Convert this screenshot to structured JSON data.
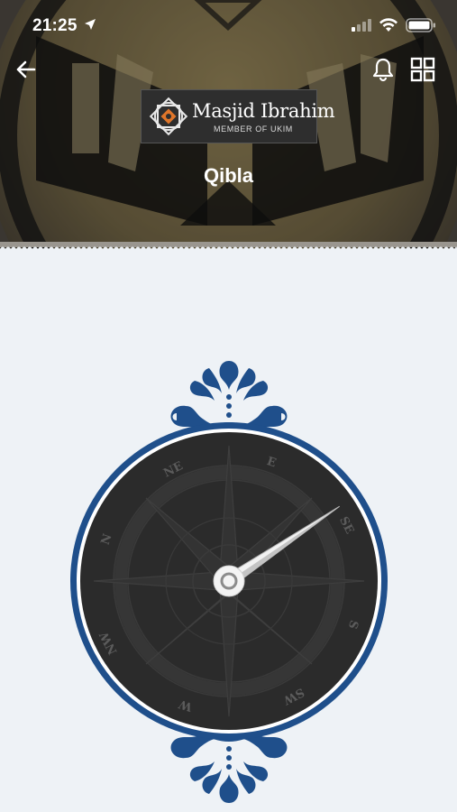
{
  "status_bar": {
    "time": "21:25",
    "icons": [
      "location-arrow-icon",
      "cellular-signal-icon",
      "wifi-icon",
      "battery-icon"
    ]
  },
  "header": {
    "logo": {
      "name": "Masjid Ibrahim",
      "subtitle": "MEMBER OF UKIM"
    },
    "title": "Qibla",
    "actions": [
      "back-arrow-icon",
      "bell-icon",
      "grid-icon"
    ]
  },
  "compass": {
    "directions": [
      "N",
      "NE",
      "E",
      "SE",
      "S",
      "SW",
      "W",
      "NW"
    ],
    "needle_heading_deg": 56
  },
  "colors": {
    "accent_blue": "#1f4f8b",
    "compass_face": "#2b2b2b",
    "page_bg": "#eef2f6"
  }
}
